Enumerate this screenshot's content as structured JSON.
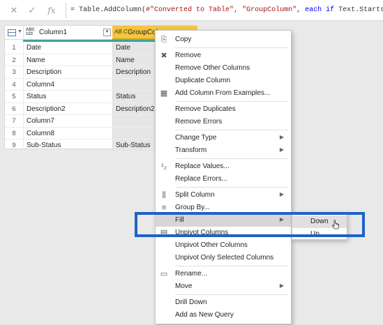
{
  "formula_bar": {
    "cancel_icon": "close-icon",
    "commit_icon": "check-icon",
    "fx_label": "fx",
    "formula_prefix": "= Table.AddColumn(",
    "formula_str1": "#\"Converted to Table\"",
    "formula_mid": ", ",
    "formula_str2": "\"GroupColumn\"",
    "formula_mid2": ", ",
    "formula_kw": "each if",
    "formula_suffix": " Text.StartsWith([Colu"
  },
  "grid": {
    "corner_icon": "table-icon",
    "columns": [
      {
        "type_label_top": "ABC",
        "type_label_bottom": "123",
        "name": "Column1"
      },
      {
        "type_label": "AB C",
        "name": "GroupColumn"
      }
    ],
    "rows": [
      {
        "num": "1",
        "c1": "Date",
        "c2": "Date"
      },
      {
        "num": "2",
        "c1": "Name",
        "c2": "Name"
      },
      {
        "num": "3",
        "c1": "Description",
        "c2": "Description"
      },
      {
        "num": "4",
        "c1": "Column4",
        "c2": ""
      },
      {
        "num": "5",
        "c1": "Status",
        "c2": "Status"
      },
      {
        "num": "6",
        "c1": "Description2",
        "c2": "Description2"
      },
      {
        "num": "7",
        "c1": "Column7",
        "c2": ""
      },
      {
        "num": "8",
        "c1": "Column8",
        "c2": ""
      },
      {
        "num": "9",
        "c1": "Sub-Status",
        "c2": "Sub-Status"
      }
    ]
  },
  "context_menu": {
    "items": [
      {
        "label": "Copy",
        "icon": "copy-icon",
        "glyph": "⎘"
      },
      {
        "label": "Remove",
        "icon": "remove-icon",
        "glyph": "✖"
      },
      {
        "label": "Remove Other Columns",
        "icon": "",
        "glyph": ""
      },
      {
        "label": "Duplicate Column",
        "icon": "",
        "glyph": ""
      },
      {
        "label": "Add Column From Examples...",
        "icon": "add-column-icon",
        "glyph": "▦"
      },
      {
        "label": "Remove Duplicates",
        "icon": "",
        "glyph": ""
      },
      {
        "label": "Remove Errors",
        "icon": "",
        "glyph": ""
      },
      {
        "label": "Change Type",
        "icon": "",
        "glyph": "",
        "submenu": true
      },
      {
        "label": "Transform",
        "icon": "",
        "glyph": "",
        "submenu": true
      },
      {
        "label": "Replace Values...",
        "icon": "replace-values-icon",
        "glyph": "¹₂"
      },
      {
        "label": "Replace Errors...",
        "icon": "",
        "glyph": ""
      },
      {
        "label": "Split Column",
        "icon": "split-column-icon",
        "glyph": "⫼",
        "submenu": true
      },
      {
        "label": "Group By...",
        "icon": "group-by-icon",
        "glyph": "≡"
      },
      {
        "label": "Fill",
        "icon": "",
        "glyph": "",
        "submenu": true,
        "highlighted": true
      },
      {
        "label": "Unpivot Columns",
        "icon": "unpivot-icon",
        "glyph": "▤"
      },
      {
        "label": "Unpivot Other Columns",
        "icon": "",
        "glyph": ""
      },
      {
        "label": "Unpivot Only Selected Columns",
        "icon": "",
        "glyph": ""
      },
      {
        "label": "Rename...",
        "icon": "rename-icon",
        "glyph": "▭"
      },
      {
        "label": "Move",
        "icon": "",
        "glyph": "",
        "submenu": true
      },
      {
        "label": "Drill Down",
        "icon": "",
        "glyph": ""
      },
      {
        "label": "Add as New Query",
        "icon": "",
        "glyph": ""
      }
    ]
  },
  "fill_submenu": {
    "down_label": "Down",
    "up_label": "Up"
  },
  "colors": {
    "selected_column_header": "#f3c63f",
    "highlight_box": "#1d63c8",
    "quality_bar": "#3fa39a"
  }
}
